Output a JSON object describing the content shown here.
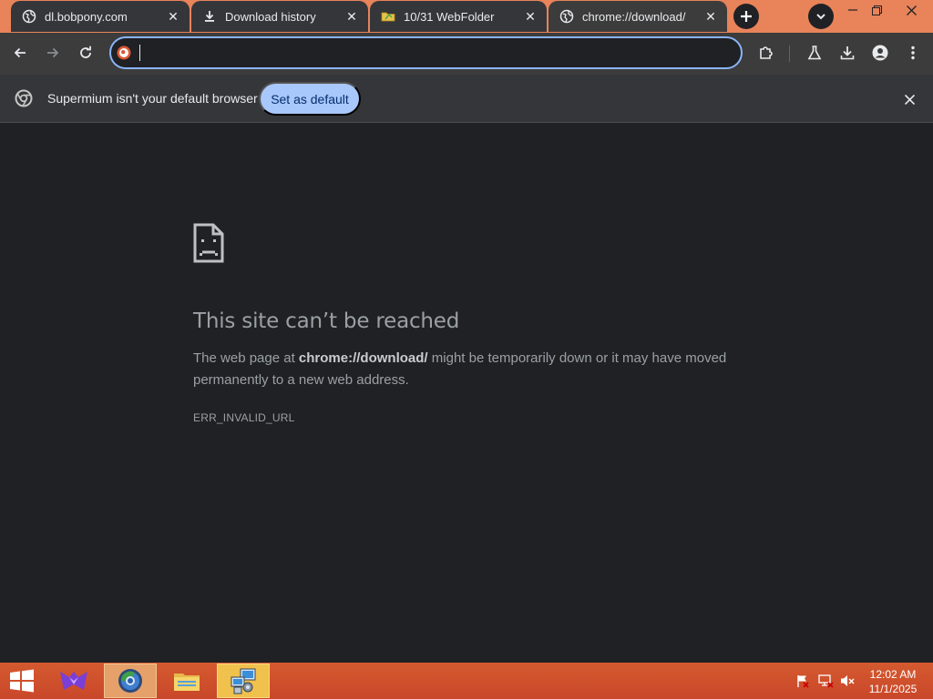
{
  "tabs": [
    {
      "title": "dl.bobpony.com",
      "favicon": "globe-icon",
      "active": false
    },
    {
      "title": "Download history",
      "favicon": "download-icon",
      "active": false
    },
    {
      "title": "10/31 WebFolder",
      "favicon": "folder-icon",
      "active": false
    },
    {
      "title": "chrome://download/",
      "favicon": "globe-icon",
      "active": true
    }
  ],
  "address_bar": {
    "value": "",
    "placeholder": ""
  },
  "infobar": {
    "message": "Supermium isn't your default browser",
    "button_label": "Set as default"
  },
  "error": {
    "title": "This site can’t be reached",
    "desc_prefix": "The web page at ",
    "url": "chrome://download/",
    "desc_suffix": " might be temporarily down or it may have moved permanently to a new web address.",
    "code": "ERR_INVALID_URL"
  },
  "taskbar": {
    "time": "12:02 AM",
    "date": "11/1/2025",
    "apps": [
      "start-icon",
      "unknown-app-icon",
      "browser-icon",
      "file-explorer-icon",
      "network-setup-icon"
    ]
  },
  "colors": {
    "accent": "#8ab4f8",
    "tabstrip": "#e8835a",
    "taskbar": "#c9472a",
    "button": "#a8c7fa"
  }
}
